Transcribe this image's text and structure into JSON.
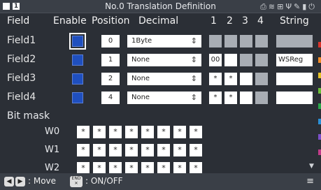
{
  "title": "No.0 Translation Definition",
  "topbar": {
    "slot_label": "1"
  },
  "headers": {
    "field": "Field",
    "enable": "Enable",
    "position": "Position",
    "decimal": "Decimal",
    "c1": "1",
    "c2": "2",
    "c3": "3",
    "c4": "4",
    "string": "String"
  },
  "rows": [
    {
      "label": "Field1",
      "position": "0",
      "decimal": "1Byte",
      "cells": [
        "",
        "",
        "",
        ""
      ],
      "cell_style": [
        "gray",
        "gray",
        "gray",
        "gray"
      ],
      "string": "",
      "string_style": "gray"
    },
    {
      "label": "Field2",
      "position": "1",
      "decimal": "None",
      "cells": [
        "00",
        "",
        "",
        ""
      ],
      "cell_style": [
        "white",
        "white",
        "gray",
        "gray"
      ],
      "string": "WSReg",
      "string_style": "white"
    },
    {
      "label": "Field3",
      "position": "2",
      "decimal": "None",
      "cells": [
        "*",
        "*",
        "",
        ""
      ],
      "cell_style": [
        "white",
        "white",
        "white",
        "gray"
      ],
      "string": "",
      "string_style": "white"
    },
    {
      "label": "Field4",
      "position": "4",
      "decimal": "None",
      "cells": [
        "*",
        "*",
        "",
        ""
      ],
      "cell_style": [
        "white",
        "white",
        "white",
        "gray"
      ],
      "string": "",
      "string_style": "white"
    }
  ],
  "bitmask": {
    "label": "Bit mask",
    "rows": [
      {
        "label": "W0",
        "bits": [
          "*",
          "*",
          "*",
          "*",
          "*",
          "*",
          "*",
          "*"
        ]
      },
      {
        "label": "W1",
        "bits": [
          "*",
          "*",
          "*",
          "*",
          "*",
          "*",
          "*",
          "*"
        ]
      },
      {
        "label": "W2",
        "bits": [
          "*",
          "*",
          "*",
          "*",
          "*",
          "*",
          "*",
          "*"
        ]
      }
    ]
  },
  "footer": {
    "move_label": ": Move",
    "end_key": "END",
    "onoff_label": ": ON/OFF"
  },
  "colors": {
    "background": "#2b2f36",
    "checkbox": "#1f4fbf",
    "tabs": [
      "#d9342b",
      "#f28c28",
      "#e6c229",
      "#6cbf3a",
      "#2aa84a",
      "#2a8fd6",
      "#7b4fc9",
      "#c23b8a"
    ]
  }
}
